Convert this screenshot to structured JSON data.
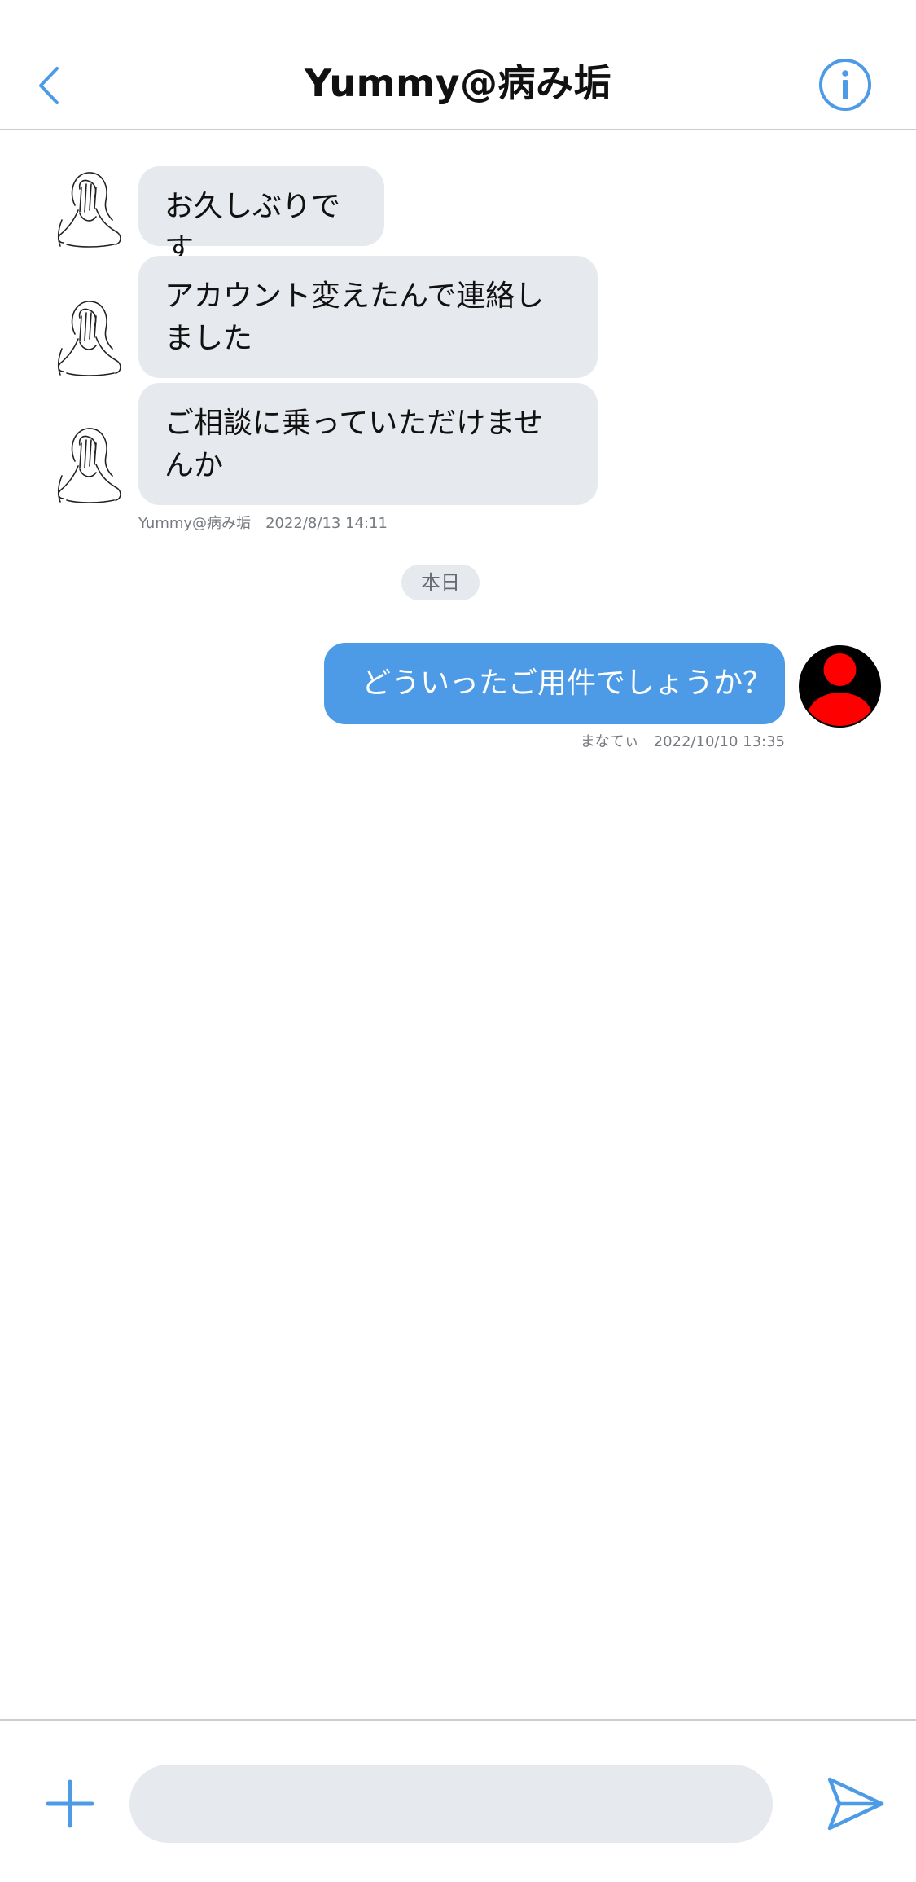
{
  "header": {
    "title": "Yummy@病み垢",
    "back_icon": "chevron-left-icon",
    "info_icon": "info-circle-icon"
  },
  "messages": [
    {
      "text": "お久しぶりです",
      "direction": "incoming"
    },
    {
      "text": "アカウント変えたんで連絡しました",
      "direction": "incoming"
    },
    {
      "text": "ご相談に乗っていただけませんか",
      "direction": "incoming"
    }
  ],
  "incoming_meta": {
    "sender": "Yummy@病み垢",
    "time": "2022/8/13 14:11"
  },
  "date_separator": "本日",
  "outgoing": {
    "text": "どういったご用件でしょうか？",
    "sender": "まなてぃ",
    "time": "2022/10/10 13:35"
  },
  "composer": {
    "value": "",
    "placeholder": "",
    "plus_icon": "plus-icon",
    "send_icon": "send-icon"
  },
  "colors": {
    "accent": "#4d9be6",
    "incoming_bubble": "#e6e9ed",
    "self_avatar_bg": "#000000",
    "self_avatar_figure": "#ff0000"
  }
}
